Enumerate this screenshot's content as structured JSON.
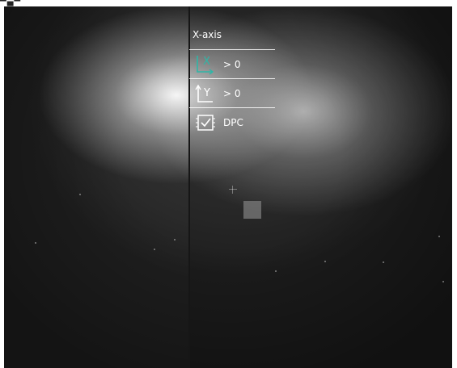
{
  "menu": {
    "title": "X-axis",
    "items": [
      {
        "name": "x-axis",
        "icon": "x-axis-icon",
        "value": "> 0",
        "selected": true
      },
      {
        "name": "y-axis",
        "icon": "y-axis-icon",
        "value": "> 0",
        "selected": false
      },
      {
        "name": "dpc",
        "icon": "dpc-checkbox-icon",
        "value": "DPC",
        "selected": false
      }
    ]
  },
  "colors": {
    "accent": "#2fb6a7",
    "text": "#ffffff",
    "background": "#202020"
  }
}
